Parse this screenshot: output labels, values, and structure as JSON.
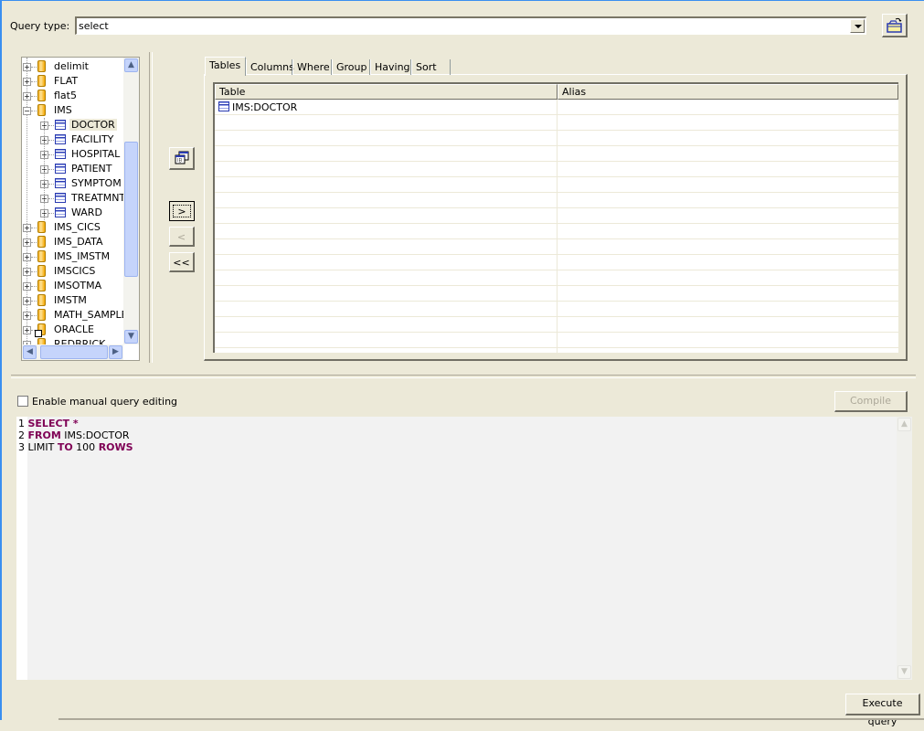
{
  "query_type": {
    "label": "Query type:",
    "value": "select"
  },
  "toolbar": {
    "open_icon": "open-folder-icon"
  },
  "tree": {
    "items": [
      {
        "label": "delimit",
        "type": "database",
        "level": 0,
        "expanded": false
      },
      {
        "label": "FLAT",
        "type": "database",
        "level": 0,
        "expanded": false
      },
      {
        "label": "flat5",
        "type": "database",
        "level": 0,
        "expanded": false
      },
      {
        "label": "IMS",
        "type": "database",
        "level": 0,
        "expanded": true
      },
      {
        "label": "DOCTOR",
        "type": "table",
        "level": 1,
        "expanded": false,
        "selected": true
      },
      {
        "label": "FACILITY",
        "type": "table",
        "level": 1,
        "expanded": false
      },
      {
        "label": "HOSPITAL",
        "type": "table",
        "level": 1,
        "expanded": false
      },
      {
        "label": "PATIENT",
        "type": "table",
        "level": 1,
        "expanded": false
      },
      {
        "label": "SYMPTOM",
        "type": "table",
        "level": 1,
        "expanded": false
      },
      {
        "label": "TREATMNT",
        "type": "table",
        "level": 1,
        "expanded": false
      },
      {
        "label": "WARD",
        "type": "table",
        "level": 1,
        "expanded": false
      },
      {
        "label": "IMS_CICS",
        "type": "database",
        "level": 0,
        "expanded": false
      },
      {
        "label": "IMS_DATA",
        "type": "database",
        "level": 0,
        "expanded": false
      },
      {
        "label": "IMS_IMSTM",
        "type": "database",
        "level": 0,
        "expanded": false
      },
      {
        "label": "IMSCICS",
        "type": "database",
        "level": 0,
        "expanded": false
      },
      {
        "label": "IMSOTMA",
        "type": "database",
        "level": 0,
        "expanded": false
      },
      {
        "label": "IMSTM",
        "type": "database",
        "level": 0,
        "expanded": false
      },
      {
        "label": "MATH_SAMPLE",
        "type": "database",
        "level": 0,
        "expanded": false
      },
      {
        "label": "ORACLE",
        "type": "database-shortcut",
        "level": 0,
        "expanded": false
      },
      {
        "label": "REDBRICK",
        "type": "database-shortcut",
        "level": 0,
        "expanded": false
      }
    ]
  },
  "transfer_buttons": {
    "copy_icon": "copy-tables-icon",
    "add": ">",
    "remove": "<",
    "remove_all": "<<"
  },
  "tabs": [
    {
      "label": "Tables",
      "active": true
    },
    {
      "label": "Columns",
      "active": false
    },
    {
      "label": "Where",
      "active": false
    },
    {
      "label": "Group",
      "active": false
    },
    {
      "label": "Having",
      "active": false
    },
    {
      "label": "Sort",
      "active": false
    }
  ],
  "grid": {
    "columns": [
      "Table",
      "Alias"
    ],
    "rows": [
      {
        "table": "IMS:DOCTOR",
        "alias": ""
      }
    ]
  },
  "manual_edit": {
    "label": "Enable manual query editing",
    "checked": false
  },
  "compile_button": "Compile query",
  "editor": {
    "lines": [
      {
        "num": "1",
        "tokens": [
          {
            "t": "SELECT *",
            "kw": true
          }
        ]
      },
      {
        "num": "2",
        "tokens": [
          {
            "t": "FROM",
            "kw": true
          },
          {
            "t": " IMS:DOCTOR",
            "kw": false
          }
        ]
      },
      {
        "num": "3",
        "tokens": [
          {
            "t": "LIMIT ",
            "kw": false
          },
          {
            "t": "TO",
            "kw": true
          },
          {
            "t": " 100 ",
            "kw": false
          },
          {
            "t": "ROWS",
            "kw": true
          }
        ]
      }
    ]
  },
  "execute_button": "Execute query"
}
